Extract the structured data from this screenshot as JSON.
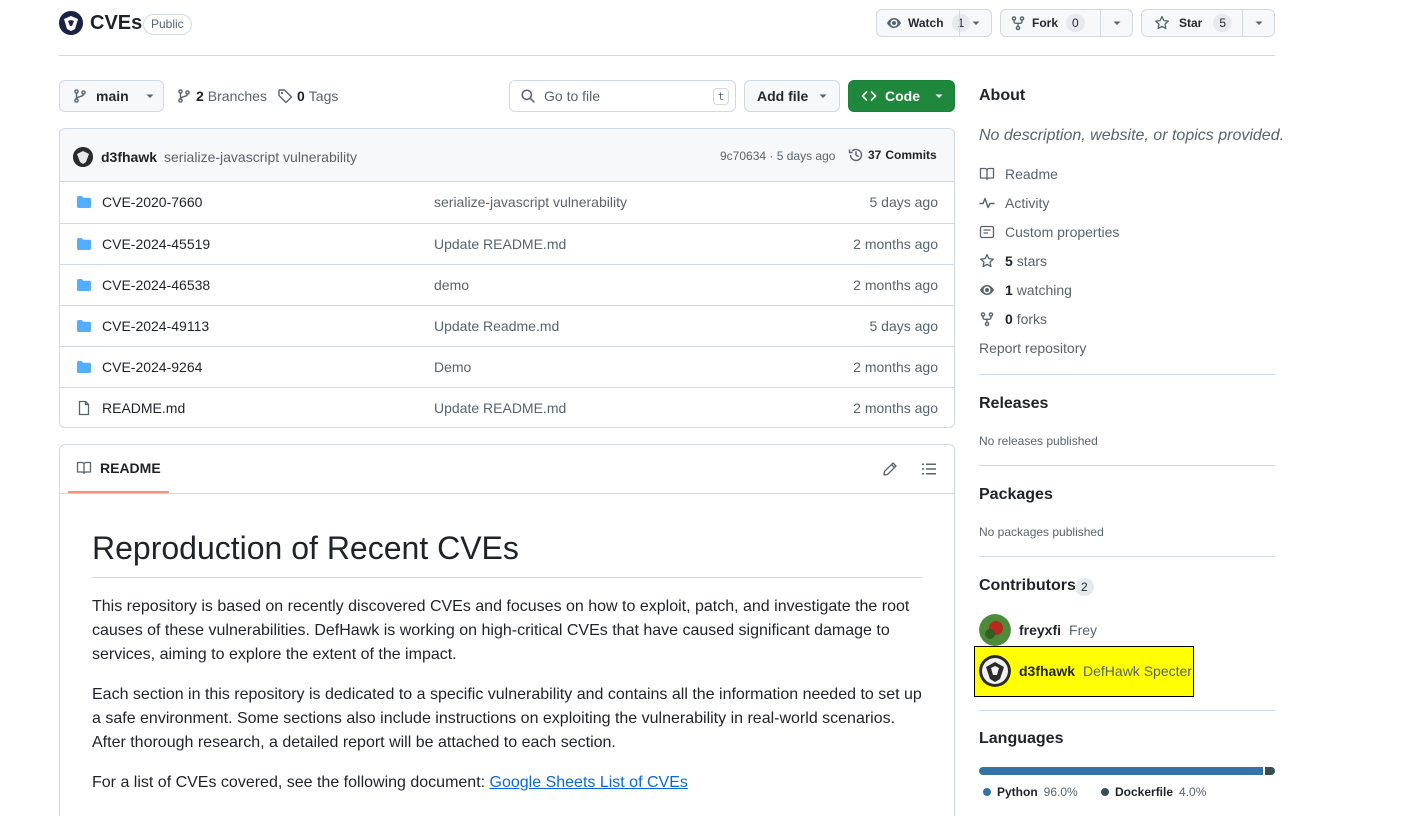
{
  "repo": {
    "name": "CVEs",
    "visibility": "Public",
    "watch": {
      "label": "Watch",
      "count": "1"
    },
    "fork": {
      "label": "Fork",
      "count": "0"
    },
    "star": {
      "label": "Star",
      "count": "5"
    }
  },
  "toolbar": {
    "branch": "main",
    "branches_count": "2",
    "branches_label": "Branches",
    "tags_count": "0",
    "tags_label": "Tags",
    "search_placeholder": "Go to file",
    "search_key": "t",
    "add_file": "Add file",
    "code": "Code"
  },
  "commit": {
    "author": "d3fhawk",
    "message": "serialize-javascript vulnerability",
    "hash_time": "9c70634 · 5 days ago",
    "commits_count": "37",
    "commits_label": "Commits"
  },
  "files": [
    {
      "name": "CVE-2020-7660",
      "message": "serialize-javascript vulnerability",
      "date": "5 days ago",
      "type": "folder"
    },
    {
      "name": "CVE-2024-45519",
      "message": "Update README.md",
      "date": "2 months ago",
      "type": "folder"
    },
    {
      "name": "CVE-2024-46538",
      "message": "demo",
      "date": "2 months ago",
      "type": "folder"
    },
    {
      "name": "CVE-2024-49113",
      "message": "Update Readme.md",
      "date": "5 days ago",
      "type": "folder"
    },
    {
      "name": "CVE-2024-9264",
      "message": "Demo",
      "date": "2 months ago",
      "type": "folder"
    },
    {
      "name": "README.md",
      "message": "Update README.md",
      "date": "2 months ago",
      "type": "file"
    }
  ],
  "readme": {
    "tab": "README",
    "title": "Reproduction of Recent CVEs",
    "para1": "This repository is based on recently discovered CVEs and focuses on how to exploit, patch, and investigate the root causes of these vulnerabilities. DefHawk is working on high-critical CVEs that have caused significant damage to services, aiming to explore the extent of the impact.",
    "para2": "Each section in this repository is dedicated to a specific vulnerability and contains all the information needed to set up a safe environment. Some sections also include instructions on exploiting the vulnerability in real-world scenarios. After thorough research, a detailed report will be attached to each section.",
    "para3_text": "For a list of CVEs covered, see the following document: ",
    "para3_link": "Google Sheets List of CVEs"
  },
  "about": {
    "heading": "About",
    "description": "No description, website, or topics provided.",
    "readme": "Readme",
    "activity": "Activity",
    "custom_properties": "Custom properties",
    "stars_count": "5",
    "stars_label": "stars",
    "watching_count": "1",
    "watching_label": "watching",
    "forks_count": "0",
    "forks_label": "forks",
    "report": "Report repository"
  },
  "releases": {
    "heading": "Releases",
    "empty": "No releases published"
  },
  "packages": {
    "heading": "Packages",
    "empty": "No packages published"
  },
  "contributors": {
    "heading": "Contributors",
    "count": "2",
    "list": [
      {
        "login": "freyxfi",
        "name": "Frey"
      },
      {
        "login": "d3fhawk",
        "name": "DefHawk Specter"
      }
    ]
  },
  "languages": {
    "heading": "Languages",
    "list": [
      {
        "name": "Python",
        "percent": "96.0%",
        "value": 96.0,
        "color": "#3572A5"
      },
      {
        "name": "Dockerfile",
        "percent": "4.0%",
        "value": 4.0,
        "color": "#384d54"
      }
    ]
  }
}
